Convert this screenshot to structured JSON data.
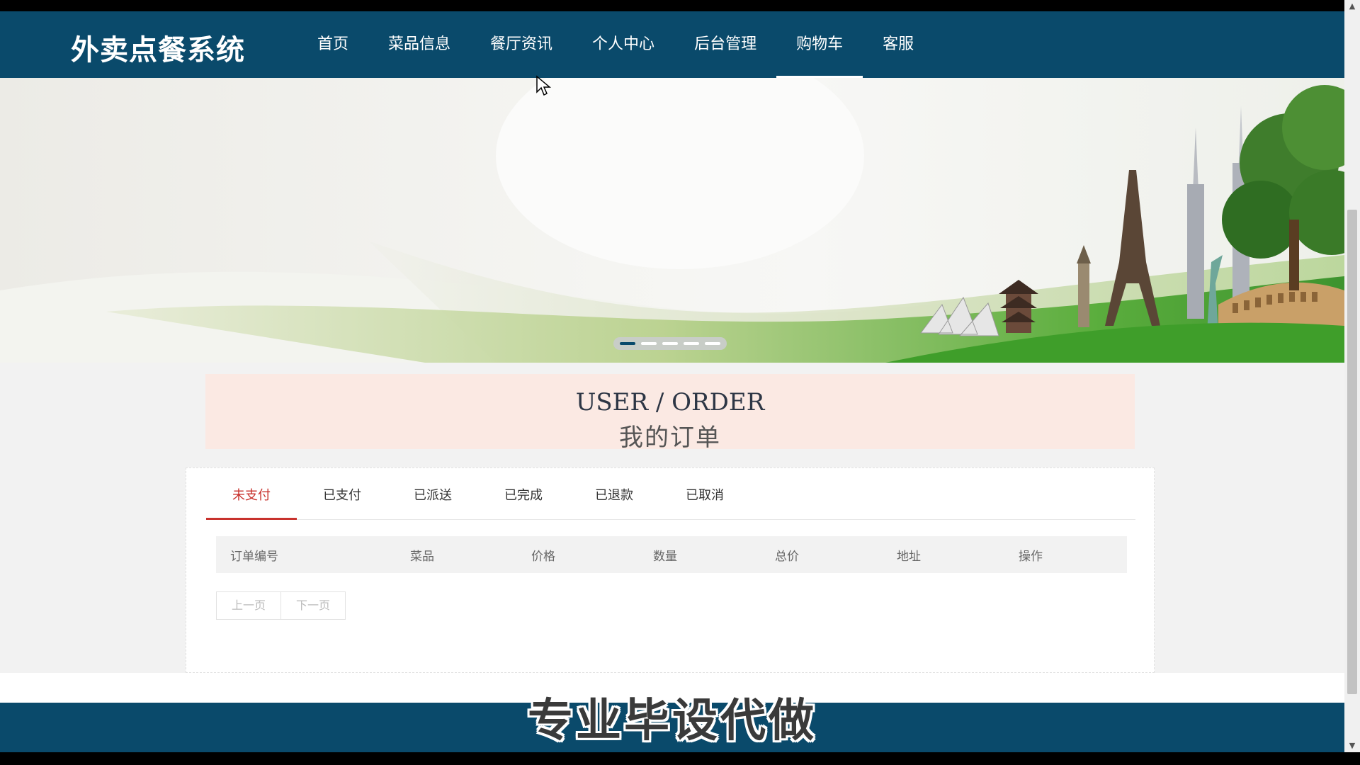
{
  "app": {
    "brand": "外卖点餐系统"
  },
  "nav": {
    "items": [
      {
        "label": "首页"
      },
      {
        "label": "菜品信息"
      },
      {
        "label": "餐厅资讯"
      },
      {
        "label": "个人中心"
      },
      {
        "label": "后台管理"
      },
      {
        "label": "购物车",
        "active": true
      },
      {
        "label": "客服"
      }
    ]
  },
  "banner": {
    "slide_count": 5,
    "active_slide": 1
  },
  "page": {
    "title_en": "USER / ORDER",
    "title_cn": "我的订单"
  },
  "orders": {
    "tabs": [
      {
        "label": "未支付",
        "active": true
      },
      {
        "label": "已支付"
      },
      {
        "label": "已派送"
      },
      {
        "label": "已完成"
      },
      {
        "label": "已退款"
      },
      {
        "label": "已取消"
      }
    ],
    "columns": [
      "订单编号",
      "菜品",
      "价格",
      "数量",
      "总价",
      "地址",
      "操作"
    ],
    "rows": [],
    "pager": {
      "prev": "上一页",
      "next": "下一页"
    }
  },
  "overlay": {
    "watermark": "专业毕设代做"
  },
  "colors": {
    "header": "#0a4a6b",
    "accent": "#c8322d",
    "title_bg": "#fbe9e3"
  }
}
